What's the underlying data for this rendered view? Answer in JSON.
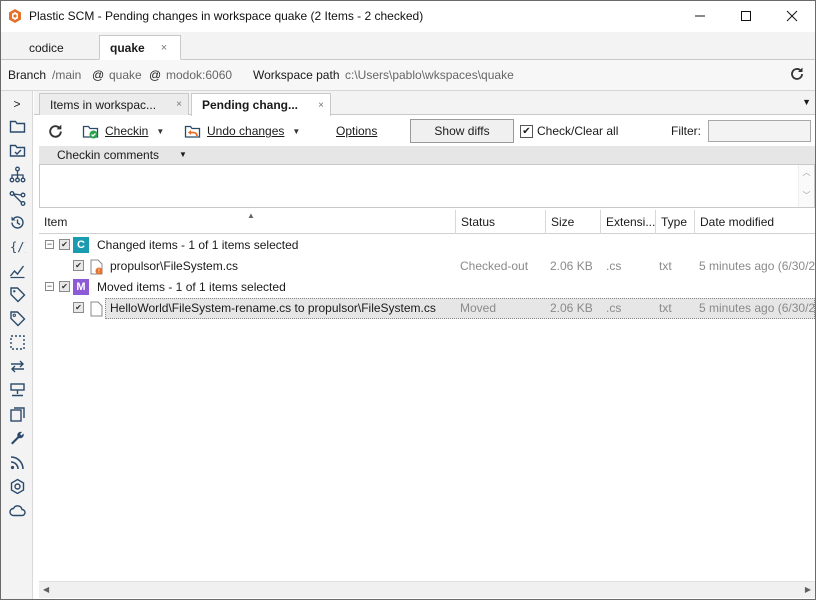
{
  "window": {
    "title": "Plastic SCM - Pending changes in workspace quake (2 Items - 2 checked)"
  },
  "workspace_tabs": [
    {
      "label": "codice",
      "active": false
    },
    {
      "label": "quake",
      "active": true,
      "close": "×"
    }
  ],
  "branch_bar": {
    "branch_label": "Branch",
    "branch_value": "/main",
    "at1": "@",
    "repo": "quake",
    "at2": "@",
    "server": "modok:6060",
    "workspace_label": "Workspace path",
    "workspace_path": "c:\\Users\\pablo\\wkspaces\\quake"
  },
  "sidebar": {
    "expand": ">",
    "icons": [
      "workspace-explorer-icon",
      "pending-changes-icon",
      "branch-explorer-icon",
      "branches-icon",
      "history-icon",
      "code-review-icon",
      "changesets-icon",
      "labels-icon",
      "attributes-icon",
      "shelves-icon",
      "sync-icon",
      "repositories-icon",
      "workspaces-icon",
      "preferences-icon",
      "feeds-icon",
      "plastic-logo-icon",
      "cloud-icon"
    ]
  },
  "view_tabs": [
    {
      "label": "Items in workspac...",
      "close": "×",
      "active": false
    },
    {
      "label": "Pending chang...",
      "close": "×",
      "active": true
    }
  ],
  "toolbar": {
    "checkin": "Checkin",
    "undo": "Undo changes",
    "options": "Options",
    "show_diffs": "Show diffs",
    "check_clear": "Check/Clear all",
    "filter_label": "Filter:",
    "filter_value": ""
  },
  "comments": {
    "header": "Checkin comments",
    "value": ""
  },
  "grid": {
    "columns": [
      "Item",
      "Status",
      "Size",
      "Extensi...",
      "Type",
      "Date modified"
    ],
    "groups": [
      {
        "badge": "C",
        "badge_color": "#1a9bb0",
        "label": "Changed items - 1 of 1 items selected",
        "rows": [
          {
            "item": "propulsor\\FileSystem.cs",
            "status": "Checked-out",
            "size": "2.06 KB",
            "ext": ".cs",
            "type": "txt",
            "date": "5 minutes ago (6/30/2"
          }
        ]
      },
      {
        "badge": "M",
        "badge_color": "#8e5bd6",
        "label": "Moved items - 1 of 1 items selected",
        "rows": [
          {
            "item": "HelloWorld\\FileSystem-rename.cs to propulsor\\FileSystem.cs",
            "status": "Moved",
            "size": "2.06 KB",
            "ext": ".cs",
            "type": "txt",
            "date": "5 minutes ago (6/30/2"
          }
        ]
      }
    ]
  }
}
